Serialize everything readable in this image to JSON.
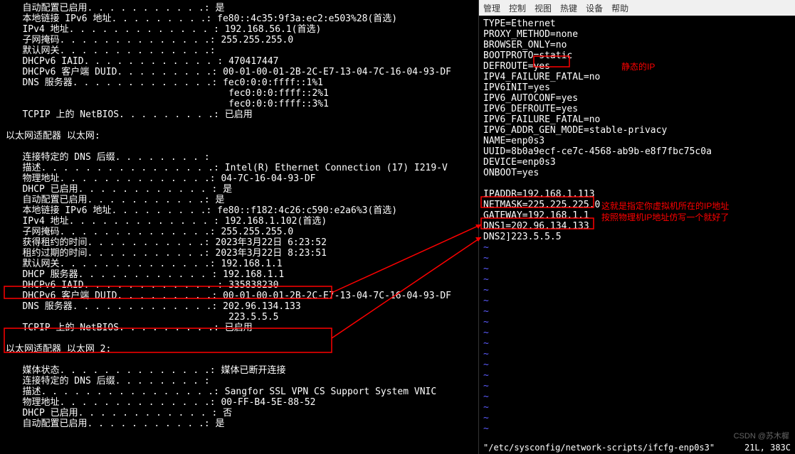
{
  "left": {
    "section1": [
      [
        "自动配置已启用",
        "是"
      ],
      [
        "本地链接 IPv6 地址",
        "fe80::4c35:9f3a:ec2:e503%28(首选)"
      ],
      [
        "IPv4 地址",
        "192.168.56.1(首选)"
      ],
      [
        "子网掩码",
        "255.255.255.0"
      ],
      [
        "默认网关",
        ""
      ],
      [
        "DHCPv6 IAID",
        "470417447"
      ],
      [
        "DHCPv6 客户端 DUID",
        "00-01-00-01-2B-2C-E7-13-04-7C-16-04-93-DF"
      ],
      [
        "DNS 服务器",
        "fec0:0:0:ffff::1%1"
      ],
      [
        "",
        "fec0:0:0:ffff::2%1"
      ],
      [
        "",
        "fec0:0:0:ffff::3%1"
      ],
      [
        "TCPIP 上的 NetBIOS",
        "已启用"
      ]
    ],
    "header2": "以太网适配器 以太网:",
    "section2": [
      [
        "连接特定的 DNS 后缀",
        ""
      ],
      [
        "描述",
        "Intel(R) Ethernet Connection (17) I219-V"
      ],
      [
        "物理地址",
        "04-7C-16-04-93-DF"
      ],
      [
        "DHCP 已启用",
        "是"
      ],
      [
        "自动配置已启用",
        "是"
      ],
      [
        "本地链接 IPv6 地址",
        "fe80::f182:4c26:c590:e2a6%3(首选)"
      ],
      [
        "IPv4 地址",
        "192.168.1.102(首选)"
      ],
      [
        "子网掩码",
        "255.255.255.0"
      ],
      [
        "获得租约的时间",
        "2023年3月22日 6:23:52"
      ],
      [
        "租约过期的时间",
        "2023年3月22日 8:23:51"
      ],
      [
        "默认网关",
        "192.168.1.1"
      ],
      [
        "DHCP 服务器",
        "192.168.1.1"
      ],
      [
        "DHCPv6 IAID",
        "335838230"
      ],
      [
        "DHCPv6 客户端 DUID",
        "00-01-00-01-2B-2C-E7-13-04-7C-16-04-93-DF"
      ],
      [
        "DNS 服务器",
        "202.96.134.133"
      ],
      [
        "",
        "223.5.5.5"
      ],
      [
        "TCPIP 上的 NetBIOS",
        "已启用"
      ]
    ],
    "header3": "以太网适配器 以太网 2:",
    "section3": [
      [
        "媒体状态",
        "媒体已断开连接"
      ],
      [
        "连接特定的 DNS 后缀",
        ""
      ],
      [
        "描述",
        "Sangfor SSL VPN CS Support System VNIC"
      ],
      [
        "物理地址",
        "00-FF-B4-5E-88-52"
      ],
      [
        "DHCP 已启用",
        "否"
      ],
      [
        "自动配置已启用",
        "是"
      ]
    ]
  },
  "menu": [
    "管理",
    "控制",
    "视图",
    "热键",
    "设备",
    "帮助"
  ],
  "vim": [
    "TYPE=Ethernet",
    "PROXY_METHOD=none",
    "BROWSER_ONLY=no",
    "BOOTPROTO=static",
    "DEFROUTE=yes",
    "IPV4_FAILURE_FATAL=no",
    "IPV6INIT=yes",
    "IPV6_AUTOCONF=yes",
    "IPV6_DEFROUTE=yes",
    "IPV6_FAILURE_FATAL=no",
    "IPV6_ADDR_GEN_MODE=stable-privacy",
    "NAME=enp0s3",
    "UUID=8b0a9ecf-ce7c-4568-ab9b-e8f7fbc75c0a",
    "DEVICE=enp0s3",
    "ONBOOT=yes",
    "",
    "IPADDR=192.168.1.113",
    "NETMASK=225.225.225.0",
    "GATEWAY=192.168.1.1",
    "DNS1=202.96.134.133",
    "DNS2]223.5.5.5"
  ],
  "annotations": {
    "static_ip": "静态的IP",
    "ipaddr_note1": "这就是指定你虚拟机所在的IP地址",
    "ipaddr_note2": "按照物理机IP地址仿写一个就好了"
  },
  "status": {
    "file": "\"/etc/sysconfig/network-scripts/ifcfg-enp0s3\"",
    "pos": "21L, 383C"
  },
  "watermark": "CSDN @苏木樨"
}
